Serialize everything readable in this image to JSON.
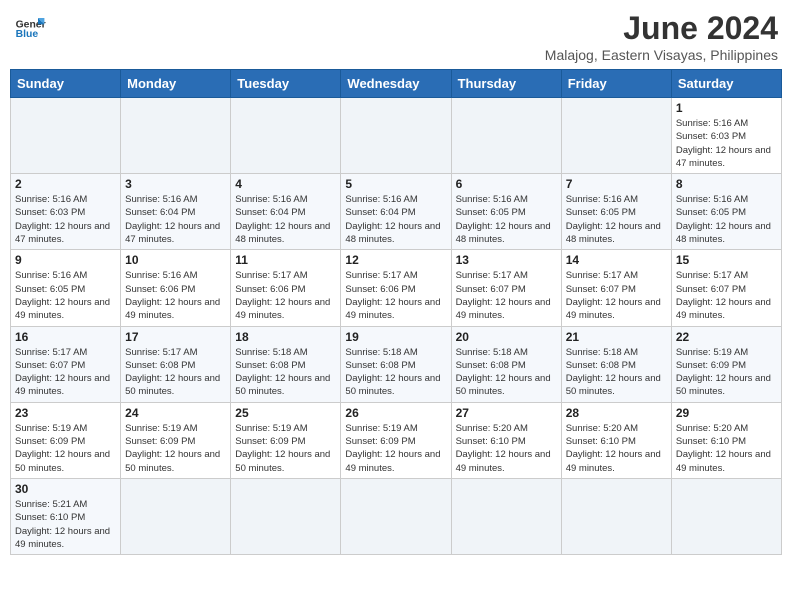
{
  "header": {
    "logo_general": "General",
    "logo_blue": "Blue",
    "title": "June 2024",
    "subtitle": "Malajog, Eastern Visayas, Philippines"
  },
  "weekdays": [
    "Sunday",
    "Monday",
    "Tuesday",
    "Wednesday",
    "Thursday",
    "Friday",
    "Saturday"
  ],
  "weeks": [
    [
      {
        "day": "",
        "info": ""
      },
      {
        "day": "",
        "info": ""
      },
      {
        "day": "",
        "info": ""
      },
      {
        "day": "",
        "info": ""
      },
      {
        "day": "",
        "info": ""
      },
      {
        "day": "",
        "info": ""
      },
      {
        "day": "1",
        "info": "Sunrise: 5:16 AM\nSunset: 6:03 PM\nDaylight: 12 hours and 47 minutes."
      }
    ],
    [
      {
        "day": "2",
        "info": "Sunrise: 5:16 AM\nSunset: 6:03 PM\nDaylight: 12 hours and 47 minutes."
      },
      {
        "day": "3",
        "info": "Sunrise: 5:16 AM\nSunset: 6:04 PM\nDaylight: 12 hours and 47 minutes."
      },
      {
        "day": "4",
        "info": "Sunrise: 5:16 AM\nSunset: 6:04 PM\nDaylight: 12 hours and 48 minutes."
      },
      {
        "day": "5",
        "info": "Sunrise: 5:16 AM\nSunset: 6:04 PM\nDaylight: 12 hours and 48 minutes."
      },
      {
        "day": "6",
        "info": "Sunrise: 5:16 AM\nSunset: 6:05 PM\nDaylight: 12 hours and 48 minutes."
      },
      {
        "day": "7",
        "info": "Sunrise: 5:16 AM\nSunset: 6:05 PM\nDaylight: 12 hours and 48 minutes."
      },
      {
        "day": "8",
        "info": "Sunrise: 5:16 AM\nSunset: 6:05 PM\nDaylight: 12 hours and 48 minutes."
      }
    ],
    [
      {
        "day": "9",
        "info": "Sunrise: 5:16 AM\nSunset: 6:05 PM\nDaylight: 12 hours and 49 minutes."
      },
      {
        "day": "10",
        "info": "Sunrise: 5:16 AM\nSunset: 6:06 PM\nDaylight: 12 hours and 49 minutes."
      },
      {
        "day": "11",
        "info": "Sunrise: 5:17 AM\nSunset: 6:06 PM\nDaylight: 12 hours and 49 minutes."
      },
      {
        "day": "12",
        "info": "Sunrise: 5:17 AM\nSunset: 6:06 PM\nDaylight: 12 hours and 49 minutes."
      },
      {
        "day": "13",
        "info": "Sunrise: 5:17 AM\nSunset: 6:07 PM\nDaylight: 12 hours and 49 minutes."
      },
      {
        "day": "14",
        "info": "Sunrise: 5:17 AM\nSunset: 6:07 PM\nDaylight: 12 hours and 49 minutes."
      },
      {
        "day": "15",
        "info": "Sunrise: 5:17 AM\nSunset: 6:07 PM\nDaylight: 12 hours and 49 minutes."
      }
    ],
    [
      {
        "day": "16",
        "info": "Sunrise: 5:17 AM\nSunset: 6:07 PM\nDaylight: 12 hours and 49 minutes."
      },
      {
        "day": "17",
        "info": "Sunrise: 5:17 AM\nSunset: 6:08 PM\nDaylight: 12 hours and 50 minutes."
      },
      {
        "day": "18",
        "info": "Sunrise: 5:18 AM\nSunset: 6:08 PM\nDaylight: 12 hours and 50 minutes."
      },
      {
        "day": "19",
        "info": "Sunrise: 5:18 AM\nSunset: 6:08 PM\nDaylight: 12 hours and 50 minutes."
      },
      {
        "day": "20",
        "info": "Sunrise: 5:18 AM\nSunset: 6:08 PM\nDaylight: 12 hours and 50 minutes."
      },
      {
        "day": "21",
        "info": "Sunrise: 5:18 AM\nSunset: 6:08 PM\nDaylight: 12 hours and 50 minutes."
      },
      {
        "day": "22",
        "info": "Sunrise: 5:19 AM\nSunset: 6:09 PM\nDaylight: 12 hours and 50 minutes."
      }
    ],
    [
      {
        "day": "23",
        "info": "Sunrise: 5:19 AM\nSunset: 6:09 PM\nDaylight: 12 hours and 50 minutes."
      },
      {
        "day": "24",
        "info": "Sunrise: 5:19 AM\nSunset: 6:09 PM\nDaylight: 12 hours and 50 minutes."
      },
      {
        "day": "25",
        "info": "Sunrise: 5:19 AM\nSunset: 6:09 PM\nDaylight: 12 hours and 50 minutes."
      },
      {
        "day": "26",
        "info": "Sunrise: 5:19 AM\nSunset: 6:09 PM\nDaylight: 12 hours and 49 minutes."
      },
      {
        "day": "27",
        "info": "Sunrise: 5:20 AM\nSunset: 6:10 PM\nDaylight: 12 hours and 49 minutes."
      },
      {
        "day": "28",
        "info": "Sunrise: 5:20 AM\nSunset: 6:10 PM\nDaylight: 12 hours and 49 minutes."
      },
      {
        "day": "29",
        "info": "Sunrise: 5:20 AM\nSunset: 6:10 PM\nDaylight: 12 hours and 49 minutes."
      }
    ],
    [
      {
        "day": "30",
        "info": "Sunrise: 5:21 AM\nSunset: 6:10 PM\nDaylight: 12 hours and 49 minutes."
      },
      {
        "day": "",
        "info": ""
      },
      {
        "day": "",
        "info": ""
      },
      {
        "day": "",
        "info": ""
      },
      {
        "day": "",
        "info": ""
      },
      {
        "day": "",
        "info": ""
      },
      {
        "day": "",
        "info": ""
      }
    ]
  ]
}
